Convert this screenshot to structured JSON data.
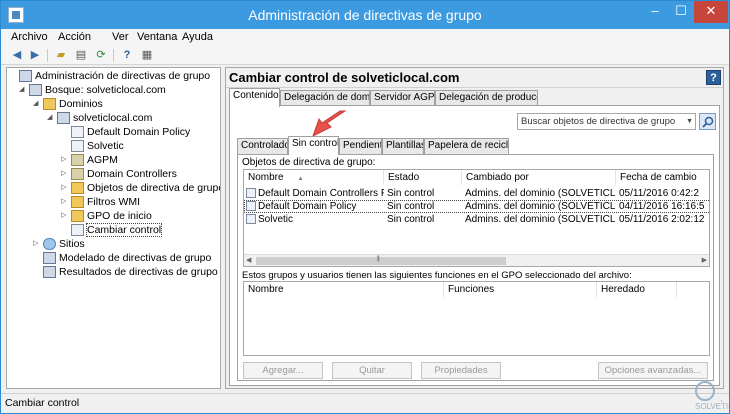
{
  "window": {
    "title": "Administración de directivas de grupo",
    "controls": {
      "minimize": "–",
      "maximize": "☐",
      "close": "✕"
    }
  },
  "menu": {
    "items": [
      "Archivo",
      "Acción",
      "Ver",
      "Ventana",
      "Ayuda"
    ]
  },
  "toolbar": {
    "icons": [
      "back-icon",
      "forward-icon",
      "folder-up-icon",
      "properties-icon",
      "refresh-icon",
      "help-icon",
      "console-tree-icon"
    ]
  },
  "tree": {
    "items": [
      {
        "label": "Administración de directivas de grupo",
        "icon": "gpmc-icon",
        "expanded": true
      },
      {
        "label": "Bosque: solveticlocal.com",
        "icon": "forest-icon",
        "expanded": true
      },
      {
        "label": "Dominios",
        "icon": "folder-icon",
        "expanded": true
      },
      {
        "label": "solveticlocal.com",
        "icon": "domain-icon",
        "expanded": true
      },
      {
        "label": "Default Domain Policy",
        "icon": "gpo-link-icon"
      },
      {
        "label": "Solvetic",
        "icon": "gpo-link-icon"
      },
      {
        "label": "AGPM",
        "icon": "ou-icon"
      },
      {
        "label": "Domain Controllers",
        "icon": "ou-icon"
      },
      {
        "label": "Objetos de directiva de grupo",
        "icon": "folder-icon"
      },
      {
        "label": "Filtros WMI",
        "icon": "folder-icon"
      },
      {
        "label": "GPO de inicio",
        "icon": "folder-icon"
      },
      {
        "label": "Cambiar control",
        "icon": "change-control-icon",
        "selected": true
      },
      {
        "label": "Sitios",
        "icon": "sites-icon"
      },
      {
        "label": "Modelado de directivas de grupo",
        "icon": "modeling-icon"
      },
      {
        "label": "Resultados de directivas de grupo",
        "icon": "results-icon"
      }
    ]
  },
  "main": {
    "title": "Cambiar control",
    "title_suffix": " de solveticlocal.com",
    "help": "?",
    "tabs": [
      "Contenido",
      "Delegación de dominio",
      "Servidor AGPM",
      "Delegación de producción"
    ],
    "active_tab": "Contenido",
    "search_placeholder": "Buscar objetos de directiva de grupo",
    "subtabs": [
      "Controlado",
      "Sin control",
      "Pendiente",
      "Plantillas",
      "Papelera de reciclaje"
    ],
    "active_subtab": "Sin control",
    "gpo_section_label": "Objetos de directiva de grupo:",
    "gpo_table": {
      "columns": [
        "Nombre",
        "Estado",
        "Cambiado por",
        "Fecha de cambio"
      ],
      "rows": [
        {
          "name": "Default Domain Controllers Policy",
          "status": "Sin control",
          "changed_by": "Admins. del dominio (SOLVETICLOC...",
          "date": "05/11/2016 0:42:2"
        },
        {
          "name": "Default Domain Policy",
          "status": "Sin control",
          "changed_by": "Admins. del dominio (SOLVETICLOC...",
          "date": "04/11/2016 16:16:5",
          "selected": true
        },
        {
          "name": "Solvetic",
          "status": "Sin control",
          "changed_by": "Admins. del dominio (SOLVETICLOC...",
          "date": "05/11/2016 2:02:12"
        }
      ]
    },
    "roles_section_label": "Estos grupos y usuarios tienen las siguientes funciones en el GPO seleccionado del archivo:",
    "roles_table": {
      "columns": [
        "Nombre",
        "Funciones",
        "Heredado"
      ]
    },
    "buttons": {
      "add": "Agregar...",
      "remove": "Quitar",
      "properties": "Propiedades",
      "advanced": "Opciones avanzadas..."
    }
  },
  "status": {
    "text": "Cambiar control"
  },
  "watermark": {
    "text": "SOLVETIC"
  },
  "colors": {
    "titlebar": "#3c9ae0",
    "close_button": "#c7463c",
    "callout_arrow": "#e8504a"
  }
}
